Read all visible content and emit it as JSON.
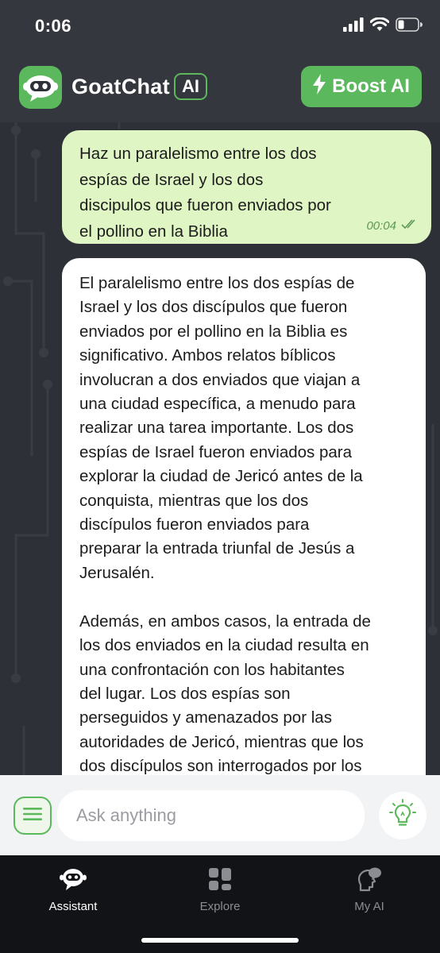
{
  "status_bar": {
    "time": "0:06",
    "icons": [
      "cellular-signal-icon",
      "wifi-icon",
      "battery-icon"
    ]
  },
  "header": {
    "app_name": "GoatChat",
    "badge": "AI",
    "logo_icon": "goat-robot-logo-icon",
    "boost_button": {
      "label": "Boost AI",
      "icon": "lightning-bolt-icon"
    }
  },
  "messages": [
    {
      "role": "user",
      "text": "Haz un paralelismo entre los dos\nespías de Israel y los dos\ndiscipulos que fueron enviados por\nel pollino en la Biblia",
      "time": "00:04",
      "status_icon": "double-check-icon"
    },
    {
      "role": "assistant",
      "text": "El paralelismo entre los dos espías de\nIsrael y los dos discípulos que fueron\nenviados por el pollino en la Biblia es\nsignificativo. Ambos relatos bíblicos\ninvolucran a dos enviados que viajan a\nuna ciudad específica, a menudo para\nrealizar una tarea importante. Los dos\nespías de Israel fueron enviados para\nexplorar la ciudad de Jericó antes de la\nconquista, mientras que los dos\ndiscípulos fueron enviados para\npreparar la entrada triunfal de Jesús a\nJerusalén.\n\nAdemás, en ambos casos, la entrada de\nlos dos enviados en la ciudad resulta en\nuna confrontación con los habitantes\ndel lugar. Los dos espías son\nperseguidos y amenazados por las\nautoridades de Jericó, mientras que los\ndos discípulos son interrogados por los"
    }
  ],
  "input_bar": {
    "placeholder": "Ask anything",
    "menu_icon": "hamburger-menu-icon",
    "suggest_icon": "lightbulb-icon"
  },
  "tab_bar": {
    "tabs": [
      {
        "label": "Assistant",
        "icon": "assistant-robot-icon",
        "active": true
      },
      {
        "label": "Explore",
        "icon": "grid-icon",
        "active": false
      },
      {
        "label": "My AI",
        "icon": "head-chat-icon",
        "active": false
      }
    ]
  },
  "colors": {
    "accent": "#5cb85c",
    "background": "#2e3037",
    "user_bubble": "#dff5c3",
    "ai_bubble": "#ffffff",
    "tab_bar": "#121317"
  }
}
